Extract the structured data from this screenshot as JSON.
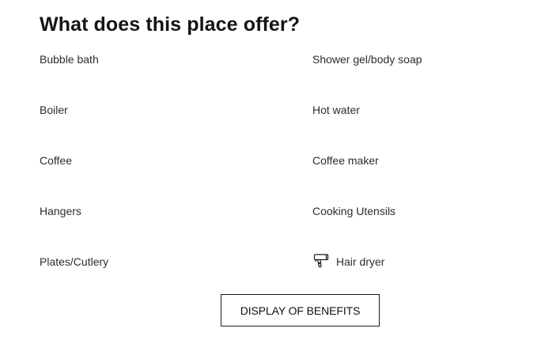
{
  "section": {
    "title": "What does this place offer?"
  },
  "amenities": [
    {
      "label": "Bubble bath",
      "icon": null
    },
    {
      "label": "Shower gel/body soap",
      "icon": null
    },
    {
      "label": "Boiler",
      "icon": null
    },
    {
      "label": "Hot water",
      "icon": null
    },
    {
      "label": "Coffee",
      "icon": null
    },
    {
      "label": "Coffee maker",
      "icon": null
    },
    {
      "label": "Hangers",
      "icon": null
    },
    {
      "label": "Cooking Utensils",
      "icon": null
    },
    {
      "label": "Plates/Cutlery",
      "icon": null
    },
    {
      "label": "Hair dryer",
      "icon": "hair-dryer-icon"
    }
  ],
  "cta": {
    "label": "DISPLAY OF BENEFITS"
  }
}
